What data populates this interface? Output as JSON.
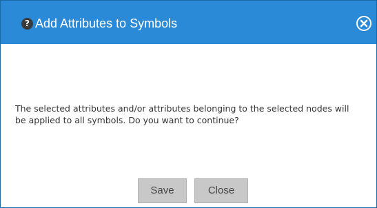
{
  "dialog": {
    "title": "Add Attributes to Symbols",
    "message": "The selected attributes and/or attributes belonging to the selected nodes will be applied to all symbols. Do you want to continue?",
    "help_icon": "question-mark-icon",
    "close_icon": "close-circle-icon",
    "buttons": {
      "save_label": "Save",
      "close_label": "Close"
    }
  },
  "colors": {
    "titlebar": "#2a8ad8",
    "button": "#c8c8c8"
  }
}
